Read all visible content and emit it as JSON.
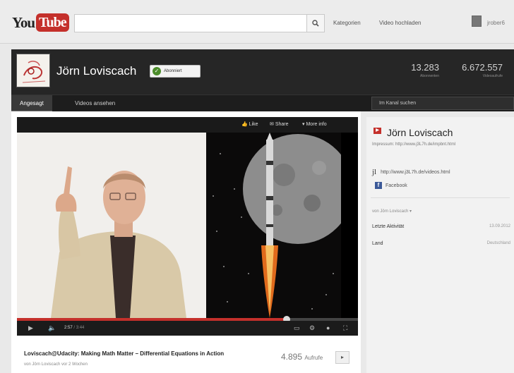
{
  "header": {
    "logo_you": "You",
    "logo_tube": "Tube",
    "search_placeholder": "",
    "search_icon": "search-icon",
    "links": [
      "Kategorien",
      "Video hochladen"
    ],
    "user": "jrober6"
  },
  "channel": {
    "name": "Jörn Loviscach",
    "subscribe_label": "Abonniert",
    "stats": [
      {
        "value": "13.283",
        "label": "Abonnenten"
      },
      {
        "value": "6.672.557",
        "label": "Videoaufrufe"
      }
    ]
  },
  "nav": {
    "tabs": [
      "Angesagt",
      "Videos ansehen"
    ],
    "active_tab": 0,
    "search_placeholder": "Im Kanal suchen"
  },
  "player": {
    "actions": [
      "Like",
      "Share",
      "More info"
    ],
    "time_current": "2:57",
    "time_total": "/ 3:44",
    "progress": 0.79
  },
  "video": {
    "title": "Loviscach@Udacity: Making Math Matter – Differential Equations in Action",
    "uploaded_by": "von Jörn Loviscach vor 2 Wochen",
    "views": "4.895",
    "views_word": "Aufrufe",
    "more_label": "▸"
  },
  "sidebar": {
    "name": "Jörn Loviscach",
    "impressum": "Impressum: http://www.j3L7h.de/impbnt.html",
    "website": "http://www.j3L7h.de/videos.html",
    "facebook": "Facebook",
    "from_label": "von Jörn Loviscach ▾",
    "rows": [
      {
        "label": "Letzte Aktivität",
        "value": "13.09.2012"
      },
      {
        "label": "Land",
        "value": "Deutschland"
      }
    ]
  },
  "colors": {
    "brand_red": "#c4302b",
    "header_dark": "#262626",
    "nav_dark": "#1d1d1d"
  }
}
